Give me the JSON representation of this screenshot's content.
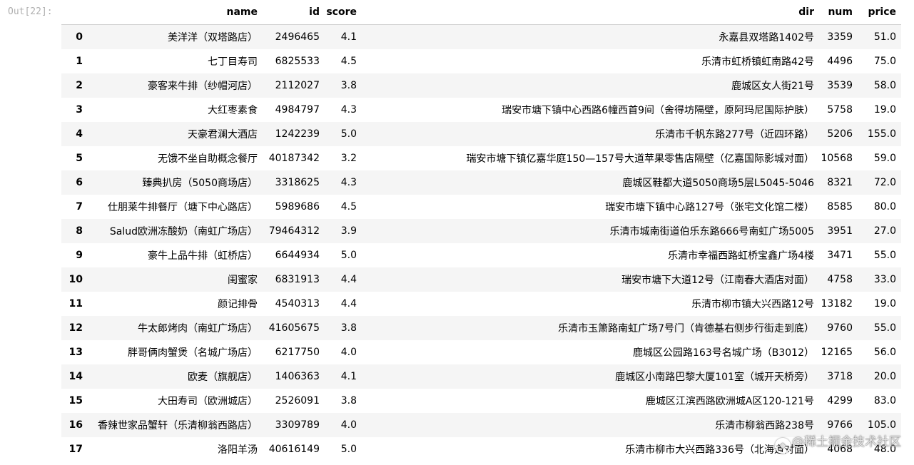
{
  "cell": {
    "prompt": "Out[22]:"
  },
  "table": {
    "columns": [
      "name",
      "id",
      "score",
      "dir",
      "num",
      "price"
    ],
    "rows": [
      {
        "idx": "0",
        "name": "美洋洋（双塔路店）",
        "id": "2496465",
        "score": "4.1",
        "dir": "永嘉县双塔路1402号",
        "num": "3359",
        "price": "51.0"
      },
      {
        "idx": "1",
        "name": "七丁目寿司",
        "id": "6825533",
        "score": "4.5",
        "dir": "乐清市虹桥镇虹南路42号",
        "num": "4496",
        "price": "75.0"
      },
      {
        "idx": "2",
        "name": "豪客来牛排（纱帽河店）",
        "id": "2112027",
        "score": "3.8",
        "dir": "鹿城区女人街21号",
        "num": "3539",
        "price": "58.0"
      },
      {
        "idx": "3",
        "name": "大红枣素食",
        "id": "4984797",
        "score": "4.3",
        "dir": "瑞安市塘下镇中心西路6幢西首9间（舍得坊隔壁，原阿玛尼国际护肤）",
        "num": "5758",
        "price": "19.0"
      },
      {
        "idx": "4",
        "name": "天豪君澜大酒店",
        "id": "1242239",
        "score": "5.0",
        "dir": "乐清市千帆东路277号（近四环路）",
        "num": "5206",
        "price": "155.0"
      },
      {
        "idx": "5",
        "name": "无饿不坐自助概念餐厅",
        "id": "40187342",
        "score": "3.2",
        "dir": "瑞安市塘下镇亿嘉华庭150—157号大道苹果零售店隔壁（亿嘉国际影城对面）",
        "num": "10568",
        "price": "59.0"
      },
      {
        "idx": "6",
        "name": "臻典扒房（5050商场店）",
        "id": "3318625",
        "score": "4.3",
        "dir": "鹿城区鞋都大道5050商场5层L5045-5046",
        "num": "8321",
        "price": "72.0"
      },
      {
        "idx": "7",
        "name": "仕朋莱牛排餐厅（塘下中心路店）",
        "id": "5989686",
        "score": "4.5",
        "dir": "瑞安市塘下镇中心路127号（张宅文化馆二楼）",
        "num": "8585",
        "price": "80.0"
      },
      {
        "idx": "8",
        "name": "Salud欧洲冻酸奶（南虹广场店）",
        "id": "79464312",
        "score": "3.9",
        "dir": "乐清市城南街道伯乐东路666号南虹广场5005",
        "num": "3951",
        "price": "27.0"
      },
      {
        "idx": "9",
        "name": "豪牛上品牛排（虹桥店）",
        "id": "6644934",
        "score": "5.0",
        "dir": "乐清市幸福西路虹桥宝鑫广场4楼",
        "num": "3471",
        "price": "55.0"
      },
      {
        "idx": "10",
        "name": "闺蜜家",
        "id": "6831913",
        "score": "4.4",
        "dir": "瑞安市塘下大道12号（江南春大酒店对面）",
        "num": "4758",
        "price": "33.0"
      },
      {
        "idx": "11",
        "name": "颜记排骨",
        "id": "4540313",
        "score": "4.4",
        "dir": "乐清市柳市镇大兴西路12号",
        "num": "13182",
        "price": "19.0"
      },
      {
        "idx": "12",
        "name": "牛太郎烤肉（南虹广场店）",
        "id": "41605675",
        "score": "3.8",
        "dir": "乐清市玉箫路南虹广场7号门（肯德基右侧步行街走到底）",
        "num": "9760",
        "price": "55.0"
      },
      {
        "idx": "13",
        "name": "胖哥俩肉蟹煲（名城广场店）",
        "id": "6217750",
        "score": "4.0",
        "dir": "鹿城区公园路163号名城广场（B3012）",
        "num": "12165",
        "price": "56.0"
      },
      {
        "idx": "14",
        "name": "欧麦（旗舰店）",
        "id": "1406363",
        "score": "4.1",
        "dir": "鹿城区小南路巴黎大厦101室（城开天桥旁）",
        "num": "3718",
        "price": "20.0"
      },
      {
        "idx": "15",
        "name": "大田寿司（欧洲城店）",
        "id": "2526091",
        "score": "3.8",
        "dir": "鹿城区江滨西路欧洲城A区120-121号",
        "num": "4299",
        "price": "83.0"
      },
      {
        "idx": "16",
        "name": "香辣世家品蟹轩（乐清柳翁西路店）",
        "id": "3309789",
        "score": "4.0",
        "dir": "乐清市柳翁西路238号",
        "num": "9766",
        "price": "105.0"
      },
      {
        "idx": "17",
        "name": "洛阳羊汤",
        "id": "40616149",
        "score": "5.0",
        "dir": "乐清市柳市大兴西路336号（北海道对面）",
        "num": "4068",
        "price": "48.0"
      }
    ]
  },
  "watermark": {
    "text": "@稀土掘金技术社区",
    "icon": "juejin-logo-icon"
  }
}
